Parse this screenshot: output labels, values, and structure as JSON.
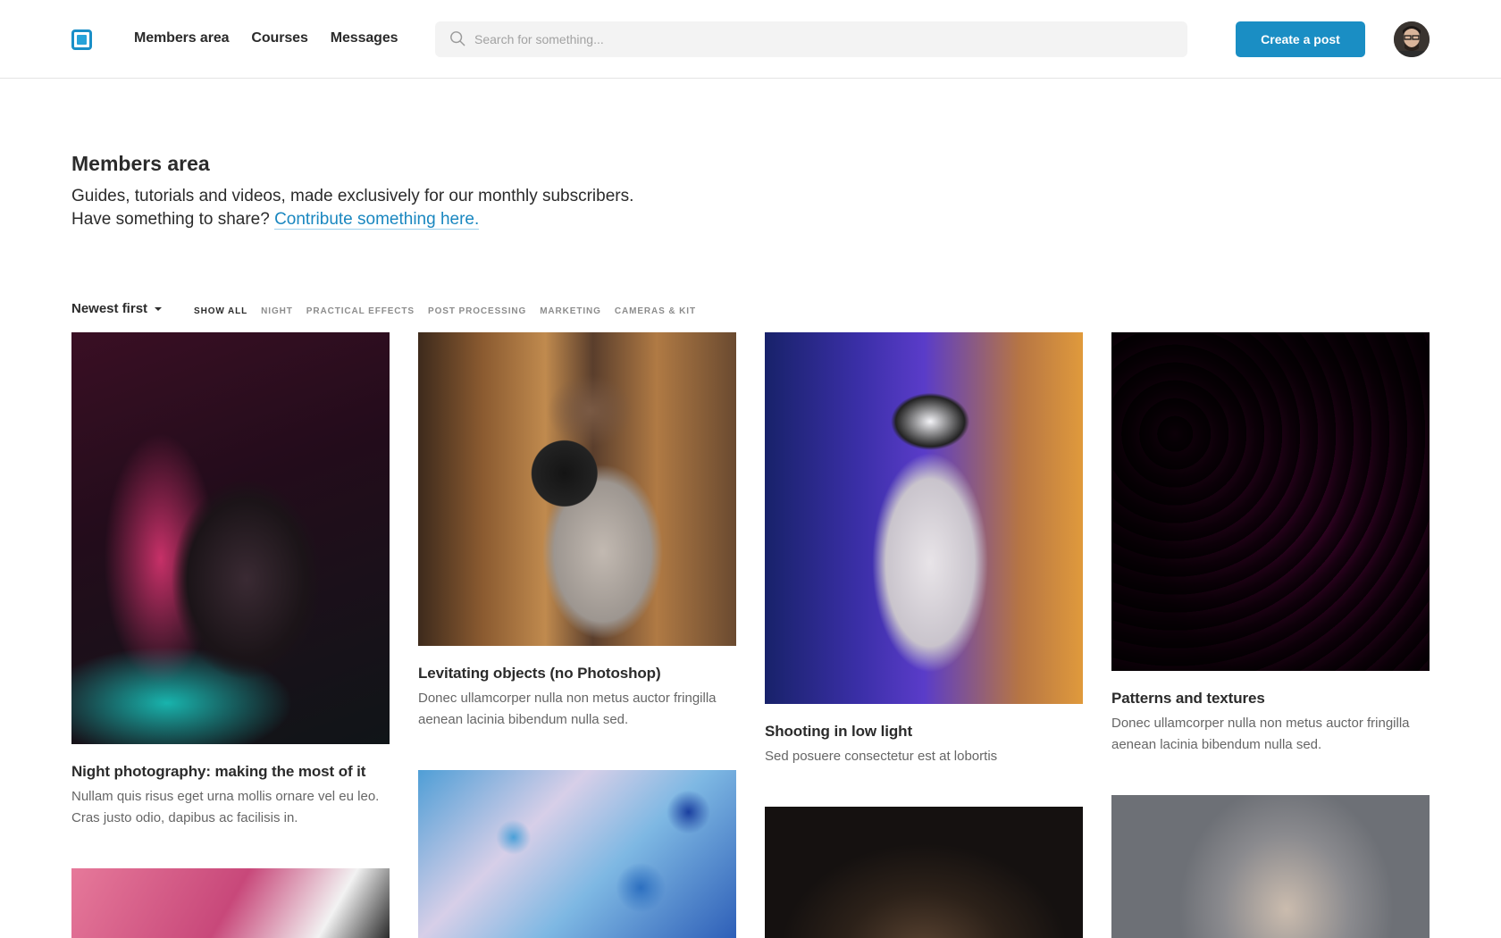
{
  "header": {
    "nav": [
      "Members area",
      "Courses",
      "Messages"
    ],
    "search_placeholder": "Search for something...",
    "create_label": "Create a post"
  },
  "intro": {
    "title": "Members area",
    "line1": "Guides, tutorials and videos, made exclusively for our monthly subscribers.",
    "line2": "Have something to share?",
    "link": "Contribute something here."
  },
  "filters": {
    "sort_label": "Newest first",
    "tags": [
      "SHOW ALL",
      "NIGHT",
      "PRACTICAL EFFECTS",
      "POST PROCESSING",
      "MARKETING",
      "CAMERAS & KIT"
    ]
  },
  "cards": [
    {
      "title": "Night photography: making the most of it",
      "desc": "Nullam quis risus eget urna mollis ornare vel eu leo. Cras justo odio, dapibus ac facilisis in."
    },
    {
      "title": "Levitating objects (no Photoshop)",
      "desc": "Donec ullamcorper nulla non metus auctor fringilla aenean lacinia bibendum nulla sed."
    },
    {
      "title": "Shooting in low light",
      "desc": "Sed posuere consectetur est at lobortis"
    },
    {
      "title": "Patterns and textures",
      "desc": "Donec ullamcorper nulla non metus auctor fringilla aenean lacinia bibendum nulla sed."
    }
  ],
  "colors": {
    "accent": "#1a8ec4",
    "link": "#1a87c0"
  }
}
